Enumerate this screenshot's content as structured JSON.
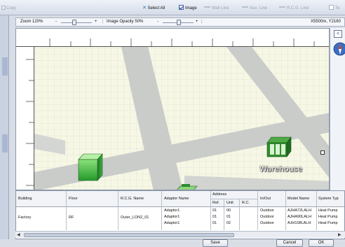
{
  "toolbar": {
    "copy_label": "Copy",
    "select_all_label": "Select All",
    "image_label": "Image",
    "wall_line_label": "Wall Line",
    "aux_line_label": "Aux. Line",
    "rcg_line_label": "R.C.G. Line",
    "text_label": "Te",
    "image_checked": true
  },
  "zoombar": {
    "zoom_label": "Zoom 120%",
    "minus": "-",
    "plus": "+",
    "opacity_label": "Image Opacity 50%",
    "opacity_minus": "-",
    "opacity_plus": "+",
    "coords": "X5500m, Y2160"
  },
  "canvas": {
    "warehouse_label": "Warehouse"
  },
  "table": {
    "headers": {
      "building": "Building",
      "floor": "Floor",
      "rcg_name": "R.C.G. Name",
      "adaptor_name": "Adaptor Name",
      "address": "Address",
      "ref": "Ref.",
      "unit": "Unit",
      "rc": "R.C.",
      "in_out": "In/Out",
      "model_name": "Model Name",
      "system_type": "System Typ"
    },
    "group": {
      "building": "Factory",
      "floor": "RF",
      "rcg_name": "Outer_LON2_01"
    },
    "rows": [
      {
        "adaptor": "Adaptor1",
        "ref": "01",
        "unit": "00",
        "rc": "",
        "inout": "Outdoor",
        "model": "AJHA72LALH",
        "system": "Heat Pump"
      },
      {
        "adaptor": "Adaptor1",
        "ref": "01",
        "unit": "01",
        "rc": "",
        "inout": "Outdoor",
        "model": "AJHA90LALH",
        "system": "Heat Pump"
      },
      {
        "adaptor": "Adaptor1",
        "ref": "01",
        "unit": "02",
        "rc": "",
        "inout": "Outdoor",
        "model": "AJH108LALH",
        "system": "Heat Pump"
      }
    ]
  },
  "buttons": {
    "save": "Save",
    "cancel": "Cancel",
    "ok": "OK"
  },
  "colors": {
    "accent": "#2f6fd0",
    "road": "#c9ccc9",
    "equipment_green": "#3fa43f"
  }
}
